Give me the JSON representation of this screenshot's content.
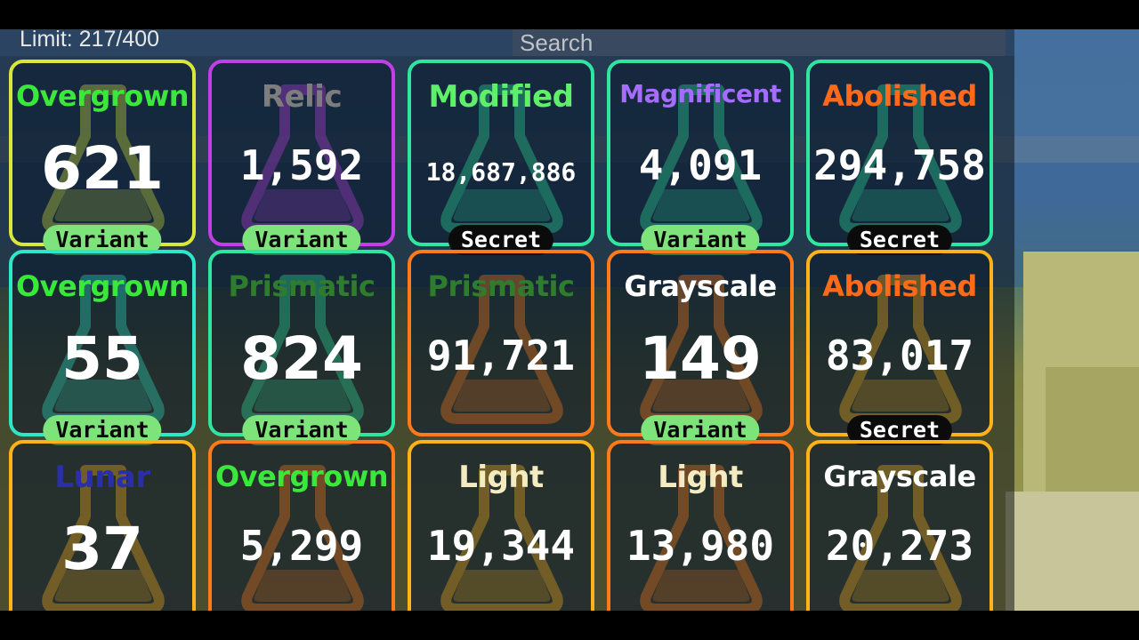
{
  "header": {
    "limit_label": "Limit: 217/400",
    "search_placeholder": "Search"
  },
  "cards": [
    {
      "title": "Overgrown",
      "title_color": "#39e83a",
      "count": "621",
      "badge": "Variant",
      "badge_type": "variant",
      "border": "#d9e63a"
    },
    {
      "title": "Relic",
      "title_color": "#7d7d7d",
      "count": "1,592",
      "badge": "Variant",
      "badge_type": "variant",
      "border": "#c23ee6"
    },
    {
      "title": "Modified",
      "title_color": "#5ff06a",
      "count": "18,687,886",
      "badge": "Secret",
      "badge_type": "secret",
      "border": "#2ee6a0"
    },
    {
      "title": "Magnificent",
      "title_color": "#a66cff",
      "count": "4,091",
      "badge": "Variant",
      "badge_type": "variant",
      "border": "#2ee6a0"
    },
    {
      "title": "Abolished",
      "title_color": "#ff6a1a",
      "count": "294,758",
      "badge": "Secret",
      "badge_type": "secret",
      "border": "#2ee6a0"
    },
    {
      "title": "Overgrown",
      "title_color": "#39e83a",
      "count": "55",
      "badge": "Variant",
      "badge_type": "variant",
      "border": "#2ee6c8"
    },
    {
      "title": "Prismatic",
      "title_color": "#2f7d2c",
      "count": "824",
      "badge": "Variant",
      "badge_type": "variant",
      "border": "#2ee6a0"
    },
    {
      "title": "Prismatic",
      "title_color": "#2f7d2c",
      "count": "91,721",
      "badge": "",
      "badge_type": "none",
      "border": "#ff7a1a"
    },
    {
      "title": "Grayscale",
      "title_color": "#ffffff",
      "count": "149",
      "badge": "Variant",
      "badge_type": "variant",
      "border": "#ff7a1a"
    },
    {
      "title": "Abolished",
      "title_color": "#ff6a1a",
      "count": "83,017",
      "badge": "Secret",
      "badge_type": "secret",
      "border": "#ffb21a"
    },
    {
      "title": "Lunar",
      "title_color": "#2a2fa8",
      "count": "37",
      "badge": "",
      "badge_type": "none",
      "border": "#ffb21a"
    },
    {
      "title": "Overgrown",
      "title_color": "#39e83a",
      "count": "5,299",
      "badge": "",
      "badge_type": "none",
      "border": "#ff7a1a"
    },
    {
      "title": "Light",
      "title_color": "#f4ecc0",
      "count": "19,344",
      "badge": "",
      "badge_type": "none",
      "border": "#ffb21a"
    },
    {
      "title": "Light",
      "title_color": "#f4ecc0",
      "count": "13,980",
      "badge": "",
      "badge_type": "none",
      "border": "#ff7a1a"
    },
    {
      "title": "Grayscale",
      "title_color": "#ffffff",
      "count": "20,273",
      "badge": "",
      "badge_type": "none",
      "border": "#ffb21a"
    }
  ],
  "colors": {
    "variant_badge": "#7de37a",
    "secret_badge": "#0b0b0b"
  },
  "icons": {
    "card_background": "potion-flask-icon"
  }
}
